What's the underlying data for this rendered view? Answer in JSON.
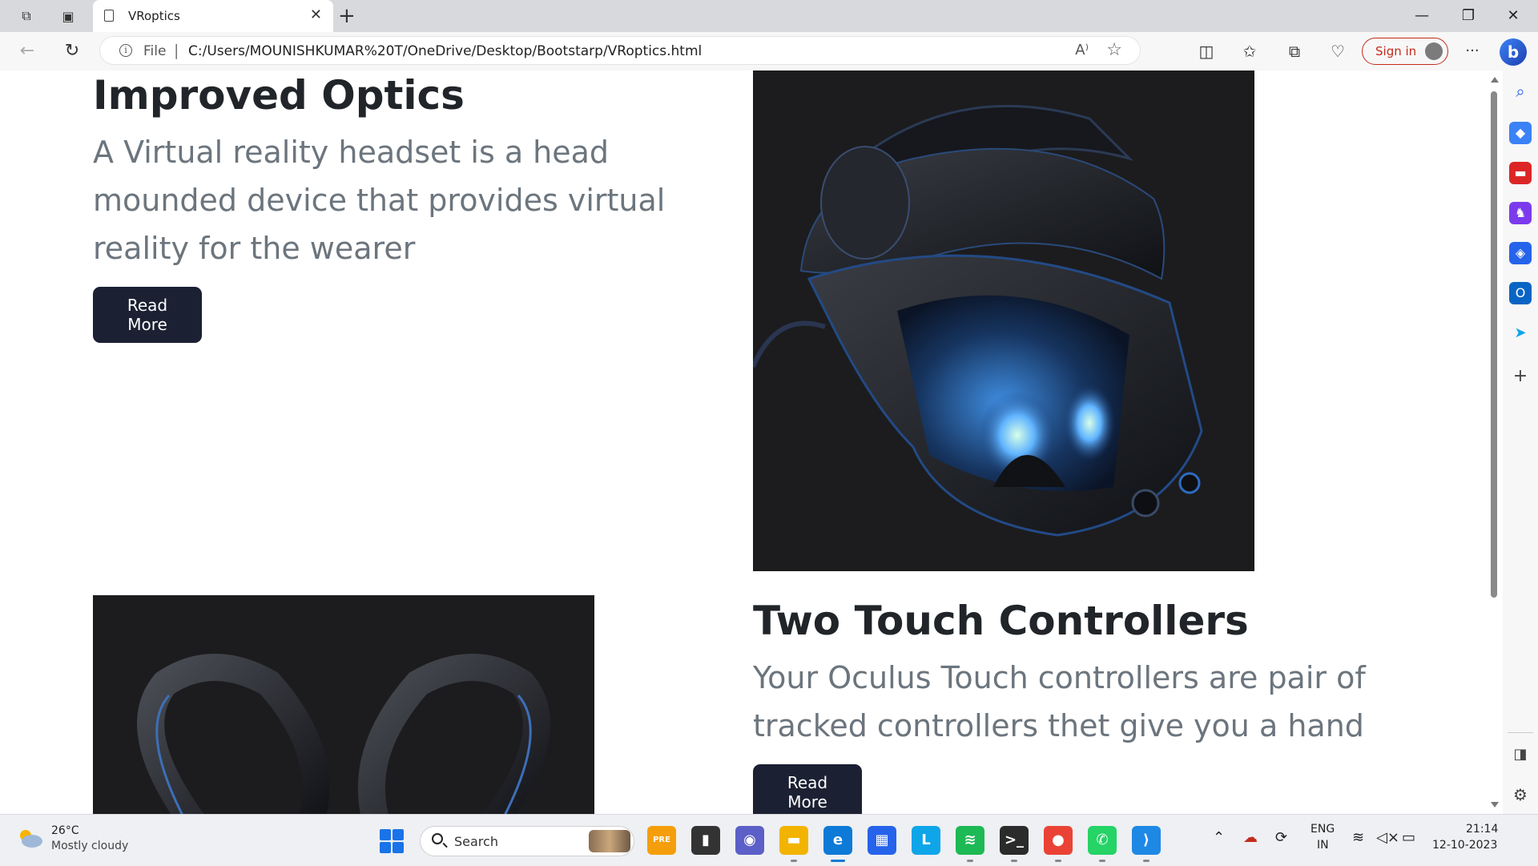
{
  "browser": {
    "tab_title": "VRoptics",
    "tab_close": "✕",
    "new_tab": "+",
    "url_scheme": "File",
    "url_separator": "|",
    "url": "C:/Users/MOUNISHKUMAR%20T/OneDrive/Desktop/Bootstarp/VRoptics.html",
    "read_aloud": "A⁾",
    "sign_in": "Sign in",
    "more": "···"
  },
  "page": {
    "section1": {
      "title": "Improved Optics",
      "text": "A Virtual reality headset is a head mounded device that provides virtual reality for the wearer",
      "button": "Read More"
    },
    "section2": {
      "title": "Two Touch Controllers",
      "text": "Your Oculus Touch controllers are pair of tracked controllers thet give you a hand",
      "button": "Read More"
    }
  },
  "taskbar": {
    "weather_temp": "26°C",
    "weather_desc": "Mostly cloudy",
    "search_placeholder": "Search",
    "lang_line1": "ENG",
    "lang_line2": "IN",
    "time": "21:14",
    "date": "12-10-2023",
    "apps": [
      {
        "name": "copilot-app",
        "glyph": "PRE",
        "color": "#f59e0b"
      },
      {
        "name": "task-view-app",
        "glyph": "▮",
        "color": "#333333"
      },
      {
        "name": "teams-chat-app",
        "glyph": "◉",
        "color": "#5b5fc7"
      },
      {
        "name": "file-explorer-app",
        "glyph": "▬",
        "color": "#f2b400"
      },
      {
        "name": "edge-app",
        "glyph": "e",
        "color": "#0c7ad6"
      },
      {
        "name": "store-app",
        "glyph": "▦",
        "color": "#2563eb"
      },
      {
        "name": "launcher-app",
        "glyph": "L",
        "color": "#0ea5e9"
      },
      {
        "name": "spotify-app",
        "glyph": "≋",
        "color": "#1db954"
      },
      {
        "name": "terminal-app",
        "glyph": ">_",
        "color": "#2b2b2b"
      },
      {
        "name": "chrome-app",
        "glyph": "●",
        "color": "#ea4335"
      },
      {
        "name": "whatsapp-app",
        "glyph": "✆",
        "color": "#25d366"
      },
      {
        "name": "vscode-app",
        "glyph": "⟩",
        "color": "#1e88e5"
      }
    ]
  },
  "colors": {
    "button_bg": "#1b2133",
    "heading": "#212529",
    "lead_text": "#6c757d",
    "signin_accent": "#c42b1c"
  }
}
